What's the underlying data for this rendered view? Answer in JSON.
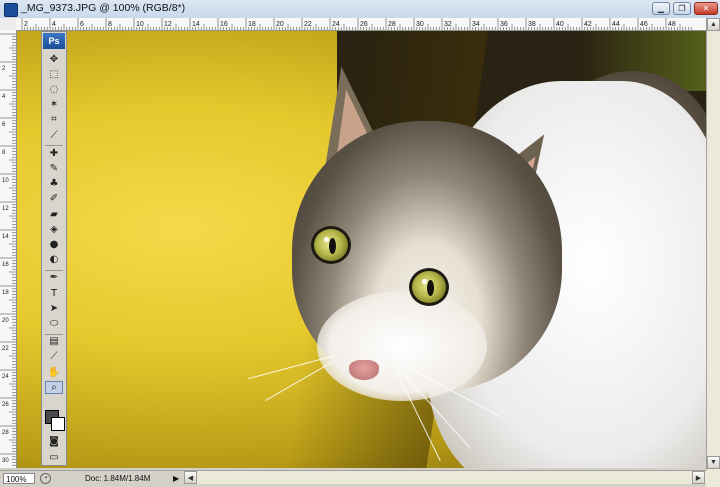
{
  "window": {
    "title": "_MG_9373.JPG @ 100% (RGB/8*)",
    "controls": [
      "minimize",
      "restore",
      "close"
    ]
  },
  "ruler": {
    "top_ticks": [
      "2",
      "4",
      "6",
      "8",
      "10",
      "12",
      "14",
      "16",
      "18",
      "20",
      "22",
      "24",
      "26",
      "28",
      "30",
      "32",
      "34",
      "36",
      "38",
      "40",
      "42",
      "44",
      "46",
      "48"
    ],
    "left_ticks": [
      "2",
      "4",
      "6",
      "8",
      "10",
      "12",
      "14",
      "16",
      "18",
      "20",
      "22",
      "24",
      "26",
      "28",
      "30"
    ]
  },
  "toolbox": {
    "logo": "Ps",
    "tools": [
      {
        "name": "move-tool-icon",
        "glyph": "✥"
      },
      {
        "name": "marquee-tool-icon",
        "glyph": "⬚"
      },
      {
        "name": "lasso-tool-icon",
        "glyph": "◌"
      },
      {
        "name": "magic-wand-tool-icon",
        "glyph": "✶"
      },
      {
        "name": "crop-tool-icon",
        "glyph": "⌗"
      },
      {
        "name": "slice-tool-icon",
        "glyph": "⟋"
      },
      {
        "name": "healing-brush-tool-icon",
        "glyph": "✚"
      },
      {
        "name": "brush-tool-icon",
        "glyph": "✎"
      },
      {
        "name": "clone-stamp-tool-icon",
        "glyph": "♣"
      },
      {
        "name": "history-brush-tool-icon",
        "glyph": "✐"
      },
      {
        "name": "eraser-tool-icon",
        "glyph": "▰"
      },
      {
        "name": "paint-bucket-tool-icon",
        "glyph": "◈"
      },
      {
        "name": "blur-tool-icon",
        "glyph": "●"
      },
      {
        "name": "dodge-tool-icon",
        "glyph": "◐"
      },
      {
        "name": "pen-tool-icon",
        "glyph": "✒"
      },
      {
        "name": "type-tool-icon",
        "glyph": "T"
      },
      {
        "name": "path-selection-tool-icon",
        "glyph": "➤"
      },
      {
        "name": "shape-tool-icon",
        "glyph": "⬭"
      },
      {
        "name": "notes-tool-icon",
        "glyph": "▤"
      },
      {
        "name": "eyedropper-tool-icon",
        "glyph": "⟋"
      },
      {
        "name": "hand-tool-icon",
        "glyph": "✋"
      },
      {
        "name": "zoom-tool-icon",
        "glyph": "⌕"
      }
    ],
    "colors": {
      "foreground": "#4a4a4a",
      "background": "#ffffff"
    },
    "mode_icons": [
      "quick-mask-icon",
      "screen-mode-icon",
      "jump-to-imageready-icon"
    ]
  },
  "status_bar": {
    "zoom": "100%",
    "doc_info": "Doc: 1.84M/1.84M"
  }
}
